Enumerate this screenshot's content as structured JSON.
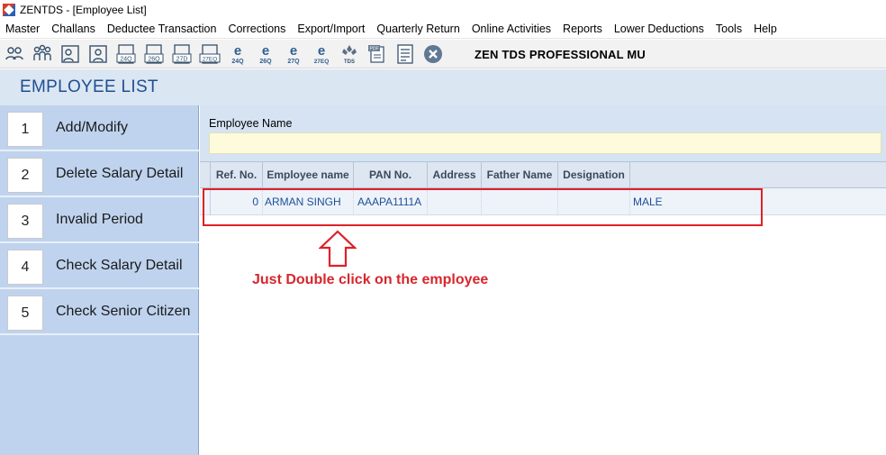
{
  "window": {
    "title": "ZENTDS - [Employee List]"
  },
  "menu": [
    "Master",
    "Challans",
    "Deductee Transaction",
    "Corrections",
    "Export/Import",
    "Quarterly Return",
    "Online Activities",
    "Reports",
    "Lower Deductions",
    "Tools",
    "Help"
  ],
  "toolbar": {
    "title": "ZEN TDS PROFESSIONAL MU",
    "icons": [
      {
        "name": "deductor-icon",
        "label": ""
      },
      {
        "name": "deductor-group-icon",
        "label": ""
      },
      {
        "name": "employee-icon",
        "label": ""
      },
      {
        "name": "employee-alt-icon",
        "label": ""
      },
      {
        "name": "form-24q-icon",
        "label": "24Q"
      },
      {
        "name": "form-26q-icon",
        "label": "26Q"
      },
      {
        "name": "form-27q-icon",
        "label": "27Q"
      },
      {
        "name": "form-27eq-icon",
        "label": "27EQ"
      },
      {
        "name": "e-return-24q-icon",
        "label": "24Q"
      },
      {
        "name": "e-return-26q-icon",
        "label": "26Q"
      },
      {
        "name": "e-return-27q-icon",
        "label": "27Q"
      },
      {
        "name": "e-return-27eq-icon",
        "label": "27EQ"
      },
      {
        "name": "tds-logo-icon",
        "label": "TDS"
      },
      {
        "name": "pdf-icon",
        "label": "PDF"
      },
      {
        "name": "notes-icon",
        "label": ""
      },
      {
        "name": "close-icon",
        "label": ""
      }
    ]
  },
  "page": {
    "title": "EMPLOYEE LIST"
  },
  "sidebar": {
    "items": [
      {
        "num": "1",
        "label": "Add/Modify"
      },
      {
        "num": "2",
        "label": "Delete Salary Detail"
      },
      {
        "num": "3",
        "label": "Invalid Period"
      },
      {
        "num": "4",
        "label": "Check Salary Detail"
      },
      {
        "num": "5",
        "label": "Check Senior Citizen"
      }
    ]
  },
  "search": {
    "label": "Employee Name",
    "value": ""
  },
  "grid": {
    "columns": [
      "Ref. No.",
      "Employee name",
      "PAN No.",
      "Address",
      "Father Name",
      "Designation"
    ],
    "rows": [
      {
        "ref": "0",
        "name": "ARMAN SINGH",
        "pan": "AAAPA1111A",
        "address": "",
        "father": "",
        "designation": "",
        "extra": "MALE"
      }
    ]
  },
  "annotation": {
    "note": "Just Double click on the employee",
    "color": "#d7262d"
  }
}
